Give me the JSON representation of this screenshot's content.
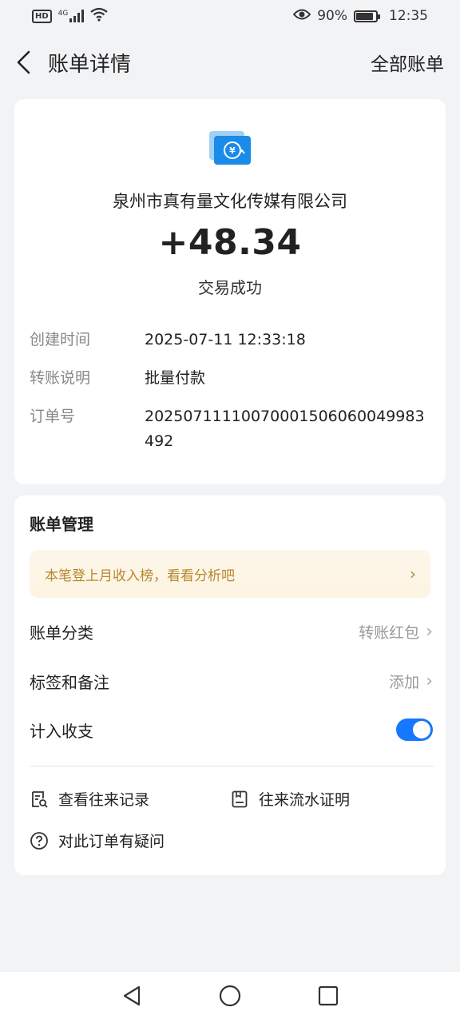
{
  "status_bar": {
    "network_badge": "HD",
    "network_type": "4G",
    "battery": "90%",
    "battery_level": 0.9,
    "time": "12:35"
  },
  "header": {
    "title": "账单详情",
    "right_link": "全部账单"
  },
  "transaction": {
    "payee": "泉州市真有量文化传媒有限公司",
    "amount": "+48.34",
    "status": "交易成功",
    "details": [
      {
        "key": "创建时间",
        "value": "2025-07-11 12:33:18"
      },
      {
        "key": "转账说明",
        "value": "批量付款"
      },
      {
        "key": "订单号",
        "value": "20250711110070001506060049983492"
      }
    ],
    "icon_color": "#1a8be8"
  },
  "management": {
    "title": "账单管理",
    "promo": "本笔登上月收入榜，看看分析吧",
    "category_label": "账单分类",
    "category_value": "转账红包",
    "tags_label": "标签和备注",
    "tags_value": "添加",
    "include_label": "计入收支",
    "include_enabled": true,
    "accent_color": "#1677ff",
    "actions": {
      "history": "查看往来记录",
      "proof": "往来流水证明",
      "question": "对此订单有疑问"
    }
  },
  "icons": [
    "back-icon",
    "eye-icon",
    "wifi-icon",
    "battery-icon",
    "transfer-icon",
    "chevron-right-icon",
    "record-search-icon",
    "document-icon",
    "question-icon",
    "nav-back-icon",
    "nav-home-icon",
    "nav-recent-icon"
  ]
}
